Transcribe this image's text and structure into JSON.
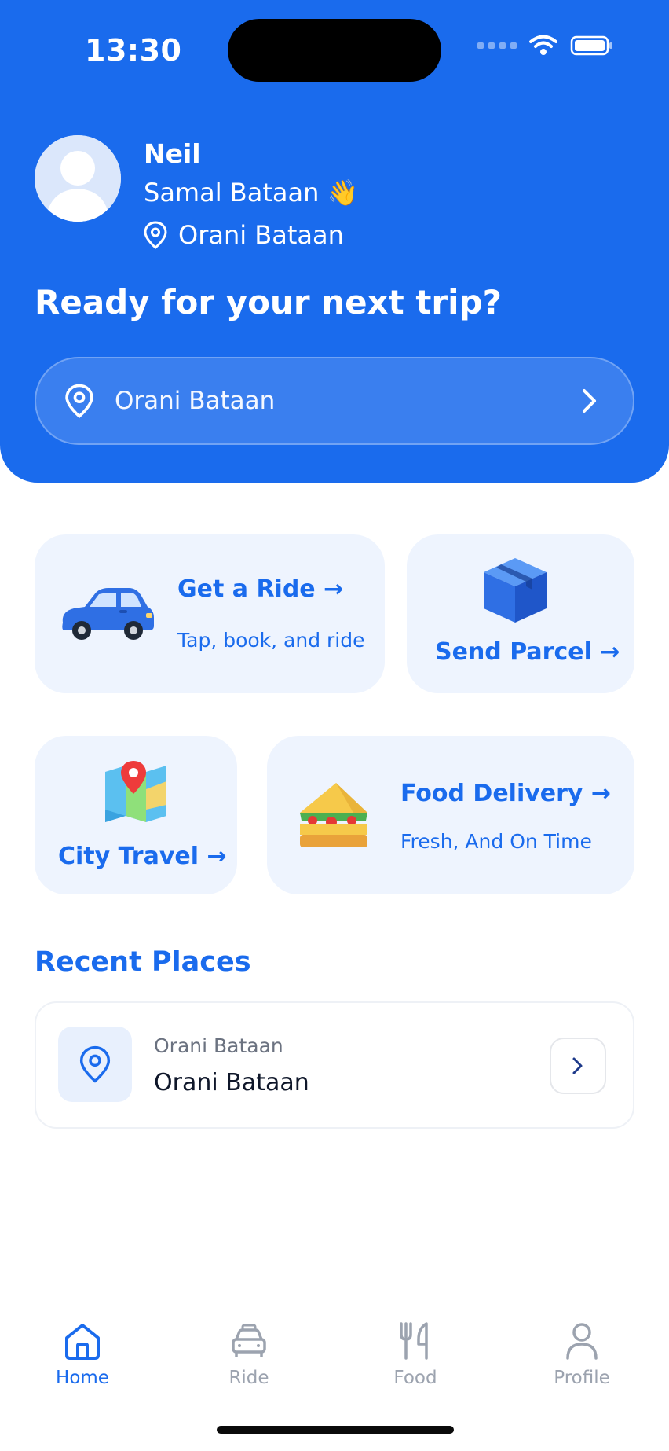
{
  "status_bar": {
    "time": "13:30"
  },
  "user": {
    "name": "Neil",
    "subtitle": "Samal Bataan 👋",
    "location": "Orani Bataan"
  },
  "headline": "Ready for your next trip?",
  "search": {
    "value": "Orani Bataan"
  },
  "services": {
    "ride": {
      "title": "Get a Ride →",
      "subtitle": "Tap, book, and ride"
    },
    "parcel": {
      "title": "Send Parcel →"
    },
    "city": {
      "title": "City Travel →"
    },
    "food": {
      "title": "Food Delivery →",
      "subtitle": "Fresh, And On Time"
    }
  },
  "recent": {
    "title": "Recent Places",
    "items": [
      {
        "label": "Orani Bataan",
        "address": "Orani Bataan"
      }
    ]
  },
  "nav": {
    "items": [
      {
        "label": "Home",
        "icon": "home-icon",
        "active": true
      },
      {
        "label": "Ride",
        "icon": "car-icon",
        "active": false
      },
      {
        "label": "Food",
        "icon": "fork-knife-icon",
        "active": false
      },
      {
        "label": "Profile",
        "icon": "person-icon",
        "active": false
      }
    ]
  },
  "colors": {
    "primary": "#1a6bed",
    "card_bg": "#eef4fe",
    "muted": "#9ca3af"
  }
}
